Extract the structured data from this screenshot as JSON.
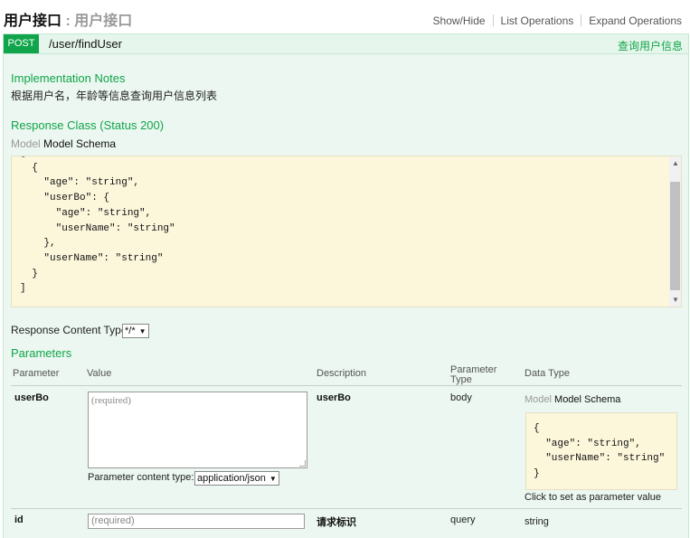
{
  "header": {
    "title": "用户接口",
    "separator": ":",
    "subtitle": "用户接口",
    "links": [
      "Show/Hide",
      "List Operations",
      "Expand Operations"
    ]
  },
  "operation": {
    "method": "POST",
    "path": "/user/findUser",
    "summary": "查询用户信息"
  },
  "implementation_notes": {
    "heading": "Implementation Notes",
    "text": "根据用户名，年龄等信息查询用户信息列表"
  },
  "response_class": {
    "heading": "Response Class (Status 200)",
    "tab_model": "Model",
    "tab_schema": "Model Schema",
    "schema_text": "[\n  {\n    \"age\": \"string\",\n    \"userBo\": {\n      \"age\": \"string\",\n      \"userName\": \"string\"\n    },\n    \"userName\": \"string\"\n  }\n]"
  },
  "response_content_type": {
    "label": "Response Content Type",
    "value": "*/*"
  },
  "parameters": {
    "heading": "Parameters",
    "columns": {
      "parameter": "Parameter",
      "value": "Value",
      "description": "Description",
      "parameter_type": "Parameter Type",
      "data_type": "Data Type"
    },
    "rows": [
      {
        "name": "userBo",
        "placeholder": "(required)",
        "content_type_label": "Parameter content type:",
        "content_type_value": "application/json",
        "description": "userBo",
        "param_type": "body",
        "dt_tab_model": "Model",
        "dt_tab_schema": "Model Schema",
        "dt_schema_text": "{\n  \"age\": \"string\",\n  \"userName\": \"string\"\n}",
        "click_hint": "Click to set as parameter value"
      },
      {
        "name": "id",
        "placeholder": "(required)",
        "description": "请求标识",
        "param_type": "query",
        "data_type": "string"
      }
    ]
  }
}
